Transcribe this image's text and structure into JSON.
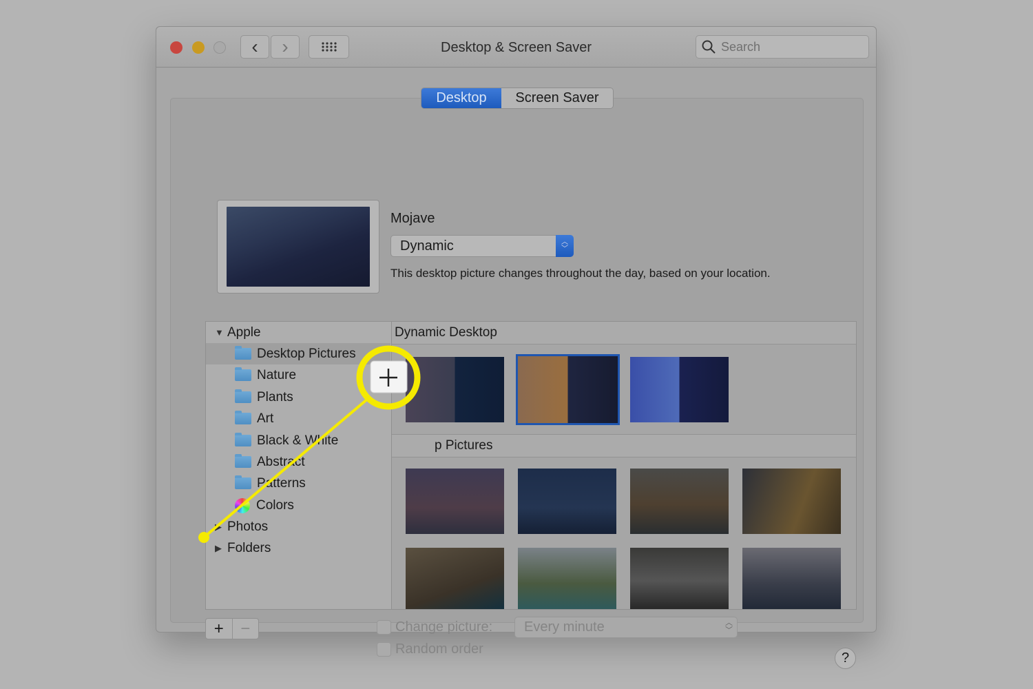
{
  "window": {
    "title": "Desktop & Screen Saver",
    "search_placeholder": "Search"
  },
  "tabs": [
    {
      "label": "Desktop",
      "active": true
    },
    {
      "label": "Screen Saver",
      "active": false
    }
  ],
  "current": {
    "name": "Mojave",
    "mode": "Dynamic",
    "description": "This desktop picture changes throughout the day, based on your location."
  },
  "sidebar": {
    "groups": [
      {
        "label": "Apple",
        "expanded": true
      },
      {
        "label": "Photos",
        "expanded": false
      },
      {
        "label": "Folders",
        "expanded": false
      }
    ],
    "items": [
      "Desktop Pictures",
      "Nature",
      "Plants",
      "Art",
      "Black & White",
      "Abstract",
      "Patterns",
      "Colors"
    ],
    "selected": "Desktop Pictures"
  },
  "sections": [
    {
      "title": "Dynamic Desktop"
    },
    {
      "title": "Desktop Pictures"
    }
  ],
  "callout_partial_text": "p Pictures",
  "options": {
    "change_picture_label": "Change picture:",
    "interval": "Every minute",
    "random_label": "Random order"
  },
  "buttons": {
    "add": "+",
    "remove": "−",
    "help": "?",
    "back": "‹",
    "forward": "›"
  },
  "colors": {
    "accent": "#2a66c9",
    "highlight": "#f5ea00"
  }
}
